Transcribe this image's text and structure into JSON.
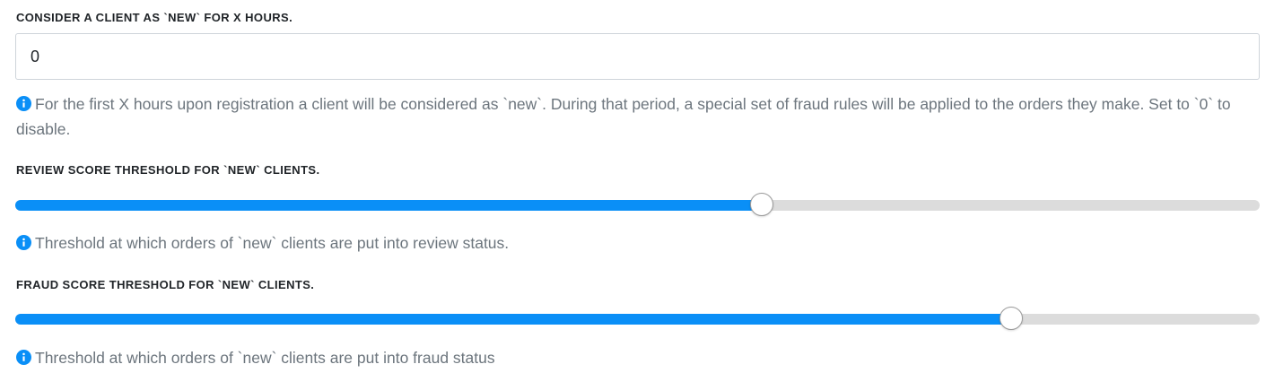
{
  "new_client_hours": {
    "label": "CONSIDER A CLIENT AS `NEW` FOR X HOURS.",
    "value": "0",
    "help_icon": "info-circle-icon",
    "help": "For the first X hours upon registration a client will be considered as `new`. During that period, a special set of fraud rules will be applied to the orders they make. Set to `0` to disable."
  },
  "review_threshold": {
    "label": "REVIEW SCORE THRESHOLD FOR `NEW` CLIENTS.",
    "level": 0.6,
    "help_icon": "info-circle-icon",
    "help": "Threshold at which orders of `new` clients are put into review status."
  },
  "fraud_threshold": {
    "label": "FRAUD SCORE THRESHOLD FOR `NEW` CLIENTS.",
    "level": 0.8,
    "help_icon": "info-circle-icon",
    "help": "Threshold at which orders of `new` clients are put into fraud status"
  },
  "colors": {
    "accent": "#0a8ff7",
    "track": "#dcdcdc",
    "help_text": "#6c757d"
  }
}
